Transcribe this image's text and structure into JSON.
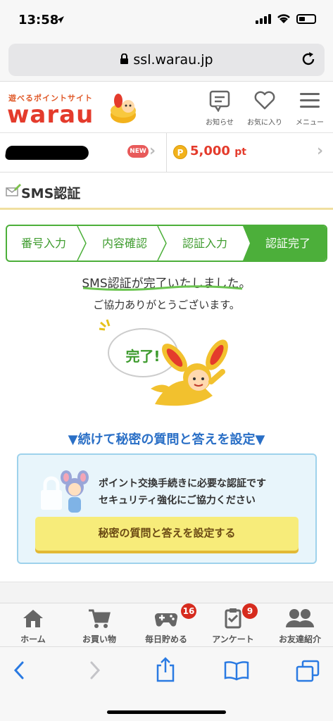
{
  "status_bar": {
    "time": "13:58"
  },
  "browser": {
    "url": "ssl.warau.jp"
  },
  "header": {
    "logo_tagline": "遊べるポイントサイト",
    "logo_text": "warau",
    "news_label": "お知らせ",
    "favorites_label": "お気に入り",
    "menu_label": "メニュー"
  },
  "user_bar": {
    "new_badge": "NEW",
    "points_value": "5,000",
    "points_unit": "pt",
    "coin_letter": "P"
  },
  "page": {
    "title": "SMS認証"
  },
  "steps": [
    "番号入力",
    "内容確認",
    "認証入力",
    "認証完了"
  ],
  "result": {
    "message": "SMS認証が完了いたしました。",
    "thanks": "ご協力ありがとうございます。",
    "bubble": "完了!"
  },
  "cta": {
    "title": "▼続けて秘密の質問と答えを設定▼",
    "line1": "ポイント交換手続きに必要な認証です",
    "line2": "セキュリティ強化にご協力ください",
    "button": "秘密の質問と答えを設定する"
  },
  "bottom_nav": {
    "home": "ホーム",
    "shopping": "お買い物",
    "daily": "毎日貯める",
    "daily_badge": "16",
    "survey": "アンケート",
    "survey_badge": "9",
    "invite": "お友達紹介"
  },
  "colors": {
    "brand_red": "#e43b2c",
    "step_green": "#4caf3a",
    "cta_blue": "#2a6fc6",
    "cta_yellow": "#f7ec7a"
  }
}
